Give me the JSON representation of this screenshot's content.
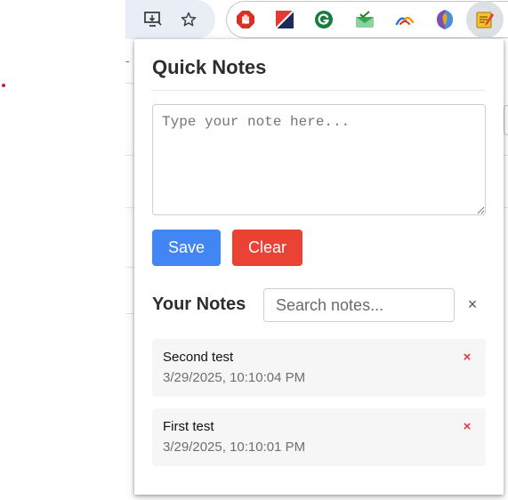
{
  "browser": {
    "toolbar_icons": [
      "install-app-icon",
      "bookmark-star-icon"
    ],
    "extensions": [
      {
        "name": "stop-hand-icon",
        "color": "#d93025"
      },
      {
        "name": "diagonal-flag-icon",
        "color": "#e53935"
      },
      {
        "name": "grammarly-icon",
        "color": "#15803d"
      },
      {
        "name": "check-mail-icon",
        "color": "#34a853"
      },
      {
        "name": "arc-waves-icon",
        "color": "#1a73e8"
      },
      {
        "name": "shield-gem-icon",
        "color": "#7b4fb3"
      },
      {
        "name": "notepad-icon",
        "color": "#f4b400"
      }
    ]
  },
  "popup": {
    "title": "Quick Notes",
    "note_placeholder": "Type your note here...",
    "save_label": "Save",
    "clear_label": "Clear",
    "notes_heading": "Your Notes",
    "search_placeholder": "Search notes...",
    "search_clear": "×",
    "delete_symbol": "×",
    "notes": [
      {
        "text": "Second test",
        "timestamp": "3/29/2025, 10:10:04 PM"
      },
      {
        "text": "First test",
        "timestamp": "3/29/2025, 10:10:01 PM"
      }
    ]
  },
  "colors": {
    "save": "#4285f4",
    "clear": "#ea4335",
    "delete": "#e53935",
    "card_bg": "#f6f6f6"
  }
}
